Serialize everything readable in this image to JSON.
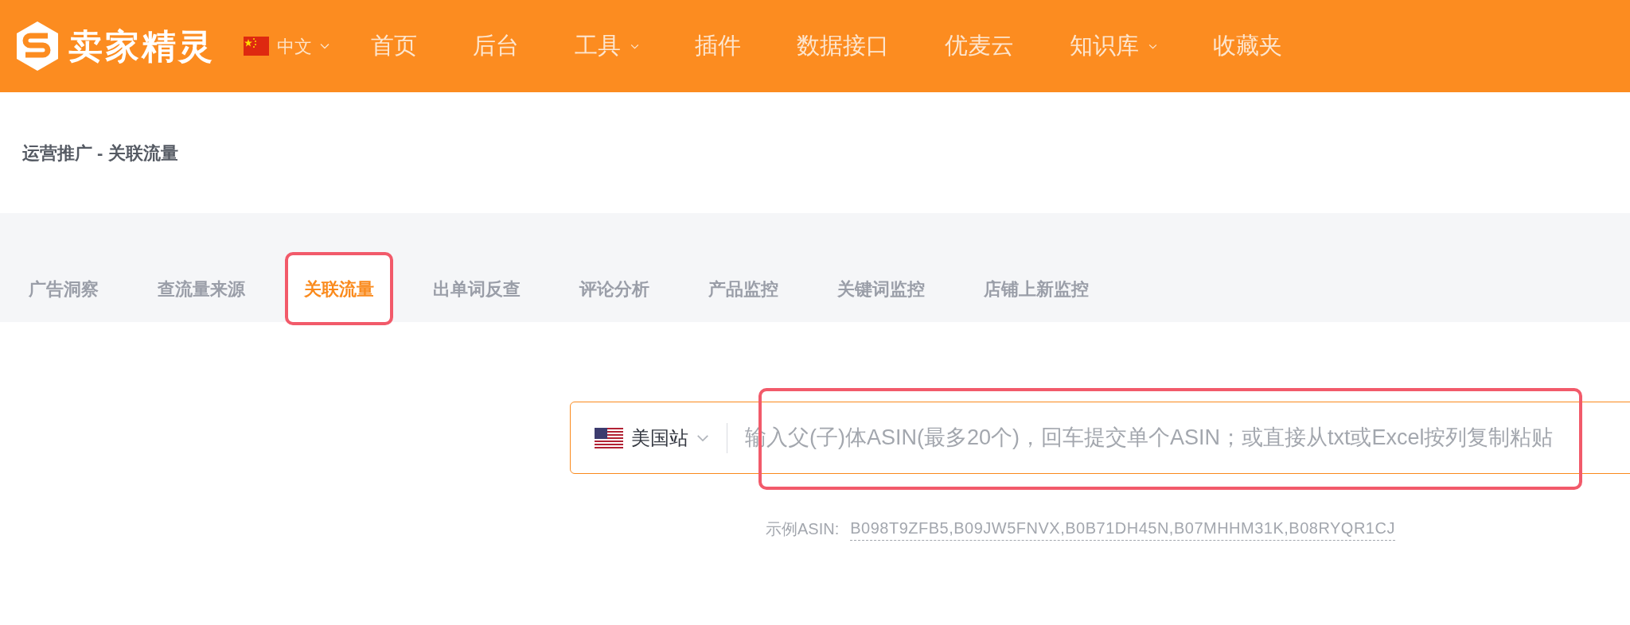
{
  "header": {
    "brand": "卖家精灵",
    "language": "中文",
    "nav": [
      {
        "label": "首页",
        "has_menu": false
      },
      {
        "label": "后台",
        "has_menu": false
      },
      {
        "label": "工具",
        "has_menu": true
      },
      {
        "label": "插件",
        "has_menu": false
      },
      {
        "label": "数据接口",
        "has_menu": false
      },
      {
        "label": "优麦云",
        "has_menu": false
      },
      {
        "label": "知识库",
        "has_menu": true
      },
      {
        "label": "收藏夹",
        "has_menu": false
      }
    ]
  },
  "breadcrumb": "运营推广 - 关联流量",
  "tabs": [
    {
      "label": "广告洞察",
      "selected": false,
      "highlighted": false
    },
    {
      "label": "查流量来源",
      "selected": false,
      "highlighted": false
    },
    {
      "label": "关联流量",
      "selected": true,
      "highlighted": true
    },
    {
      "label": "出单词反查",
      "selected": false,
      "highlighted": false
    },
    {
      "label": "评论分析",
      "selected": false,
      "highlighted": false
    },
    {
      "label": "产品监控",
      "selected": false,
      "highlighted": false
    },
    {
      "label": "关键词监控",
      "selected": false,
      "highlighted": false
    },
    {
      "label": "店铺上新监控",
      "selected": false,
      "highlighted": false
    }
  ],
  "search": {
    "marketplace": "美国站",
    "placeholder": "输入父(子)体ASIN(最多20个)，回车提交单个ASIN；或直接从txt或Excel按列复制粘贴",
    "highlighted": true
  },
  "example": {
    "label": "示例ASIN:",
    "asins": "B098T9ZFB5,B09JW5FNVX,B0B71DH45N,B07MHHM31K,B08RYQR1CJ"
  }
}
